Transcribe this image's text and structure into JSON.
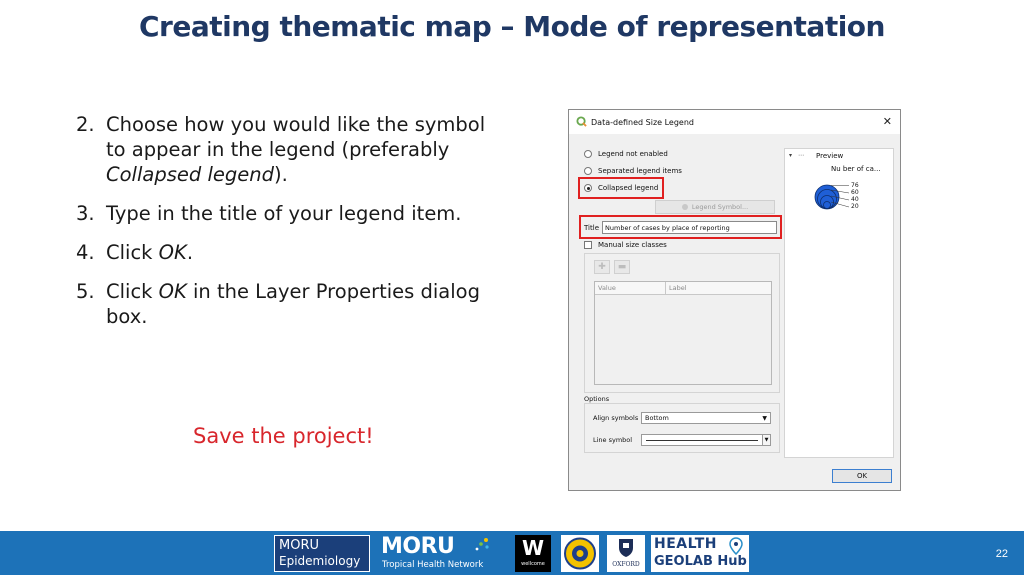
{
  "slide": {
    "title": "Creating thematic map – Mode of representation",
    "steps": [
      {
        "num": "2.",
        "text_lines": [
          "Choose how you would like the symbol",
          "to appear in the legend (preferably"
        ],
        "italic": "Collapsed legend",
        "after": ")."
      },
      {
        "num": "3.",
        "text": "Type in the title of your legend item."
      },
      {
        "num": "4.",
        "prefix": "Click ",
        "italic": "OK",
        "suffix": "."
      },
      {
        "num": "5.",
        "prefix": "Click ",
        "italic": "OK",
        "suffix": " in the Layer Properties dialog box."
      }
    ],
    "save_note": "Save the project!",
    "page_number": "22"
  },
  "dialog": {
    "title": "Data-defined Size Legend",
    "close_glyph": "✕",
    "radio_options": [
      {
        "label": "Legend not enabled",
        "checked": false
      },
      {
        "label": "Separated legend items",
        "checked": false
      },
      {
        "label": "Collapsed legend",
        "checked": true
      }
    ],
    "legend_symbol_button": "Legend Symbol...",
    "title_label": "Title",
    "title_value": "Number of cases by place of reporting",
    "manual_classes_label": "Manual size classes",
    "table_headers": [
      "Value",
      "Label"
    ],
    "options_label": "Options",
    "align_symbols_label": "Align symbols",
    "align_symbols_value": "Bottom",
    "line_symbol_label": "Line symbol",
    "preview_label": "Preview",
    "preview_layer": "Nu ber of ca...",
    "preview_values": [
      "76",
      "60",
      "40",
      "20"
    ],
    "ok_label": "OK",
    "colors": {
      "highlight": "#e02020",
      "symbol_fill": "#1f5fd6"
    }
  },
  "footer": {
    "logos": [
      {
        "icon": "moru-epidemiology-logo",
        "lines": [
          "MORU",
          "Epidemiology"
        ]
      },
      {
        "icon": "moru-network-logo",
        "lines": [
          "MORU",
          "Tropical Health Network"
        ]
      },
      {
        "icon": "wellcome-logo",
        "lines": [
          "W",
          "wellcome"
        ]
      },
      {
        "icon": "university-seal-logo"
      },
      {
        "icon": "oxford-logo",
        "lines": [
          "OXFORD"
        ]
      },
      {
        "icon": "health-geolab-logo",
        "lines": [
          "HEALTH",
          "GEOLAB Hub"
        ]
      }
    ],
    "color": "#1d72b8"
  }
}
